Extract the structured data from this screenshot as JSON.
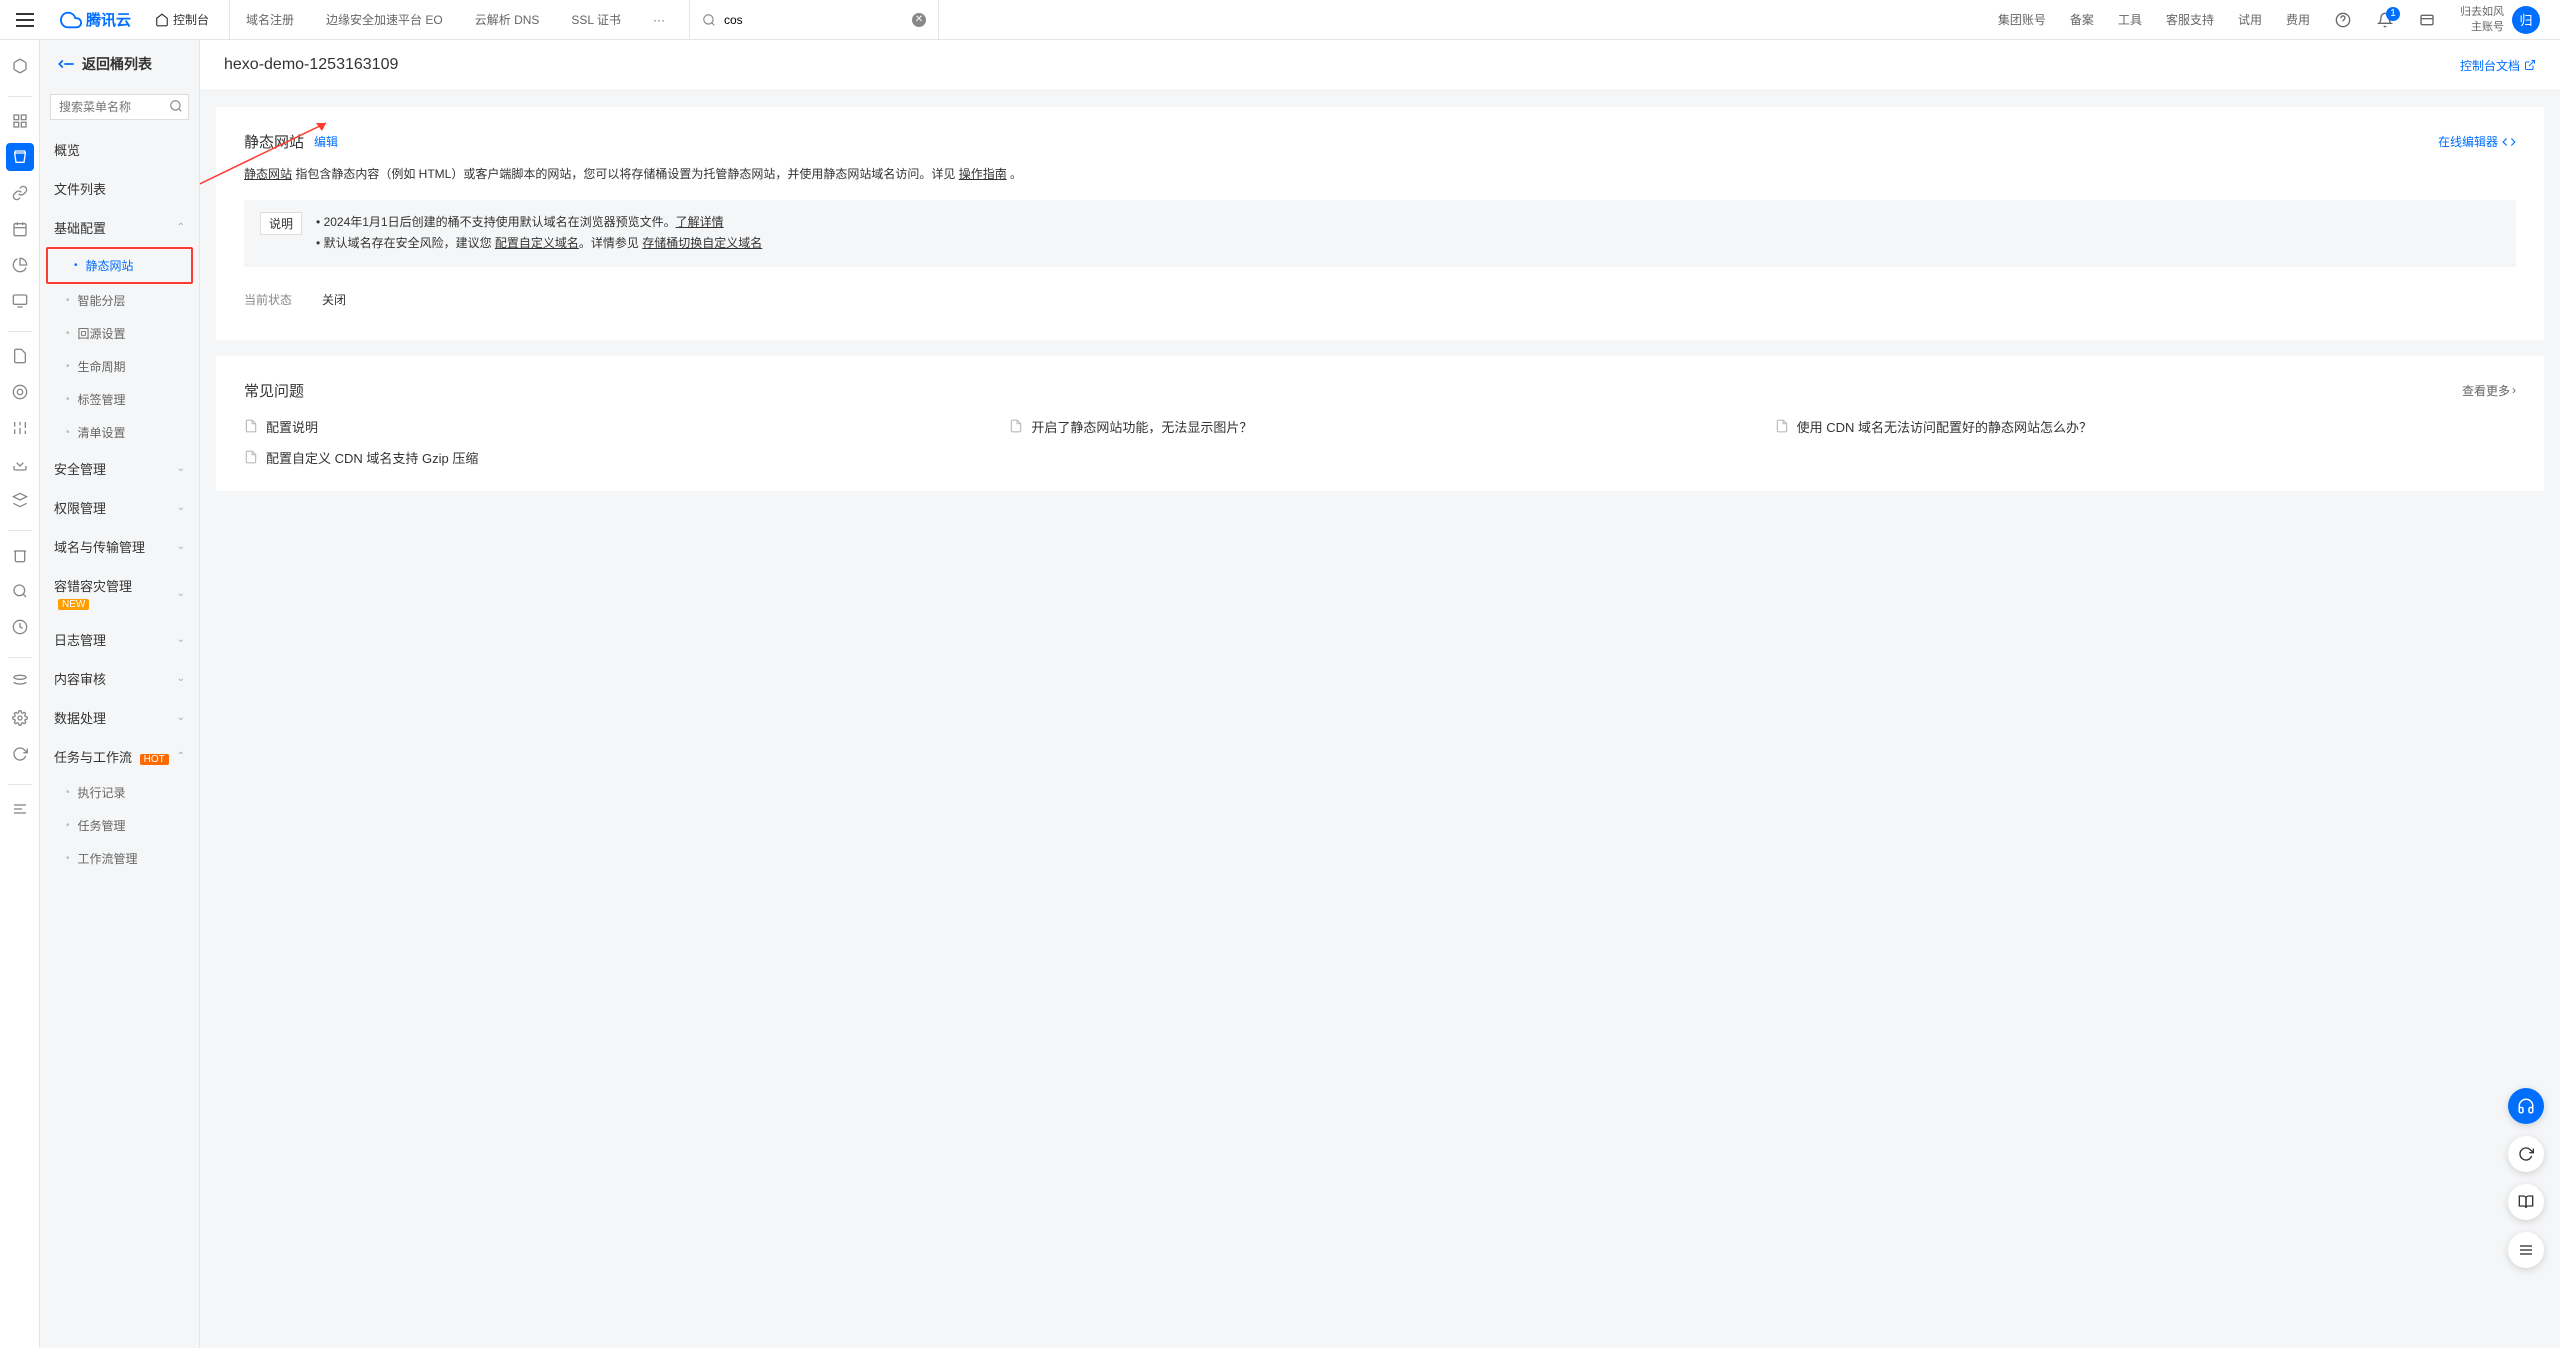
{
  "header": {
    "brand": "腾讯云",
    "console": "控制台",
    "nav": [
      "域名注册",
      "边缘安全加速平台 EO",
      "云解析 DNS",
      "SSL 证书",
      "···"
    ],
    "search_value": "cos",
    "right_links": [
      "集团账号",
      "备案",
      "工具",
      "客服支持",
      "试用",
      "费用"
    ],
    "notif_count": "1",
    "user_name": "归去如风",
    "user_sub": "主账号",
    "avatar_char": "归"
  },
  "sidebar": {
    "back": "返回桶列表",
    "search_placeholder": "搜索菜单名称",
    "items": {
      "overview": "概览",
      "filelist": "文件列表",
      "basic_config": "基础配置",
      "static_site": "静态网站",
      "smart_tier": "智能分层",
      "origin": "回源设置",
      "lifecycle": "生命周期",
      "tags": "标签管理",
      "inventory": "清单设置",
      "security": "安全管理",
      "permission": "权限管理",
      "domain_transport": "域名与传输管理",
      "fault_tolerant": "容错容灾管理",
      "log": "日志管理",
      "content_audit": "内容审核",
      "data_process": "数据处理",
      "task_workflow": "任务与工作流",
      "exec_record": "执行记录",
      "task_mgmt": "任务管理",
      "workflow_mgmt": "工作流管理",
      "new_badge": "NEW",
      "hot_badge": "HOT"
    }
  },
  "page": {
    "title": "hexo-demo-1253163109",
    "doc_link": "控制台文档"
  },
  "static_site": {
    "title": "静态网站",
    "edit": "编辑",
    "online_editor": "在线编辑器",
    "desc_prefix": "静态网站",
    "desc_body": " 指包含静态内容（例如 HTML）或客户端脚本的网站，您可以将存储桶设置为托管静态网站，并使用静态网站域名访问。详见 ",
    "desc_guide": "操作指南",
    "desc_period": " 。",
    "info_label": "说明",
    "info_bullet1_a": "2024年1月1日后创建的桶不支持使用默认域名在浏览器预览文件。",
    "info_bullet1_link": "了解详情",
    "info_bullet2_a": "默认域名存在安全风险，建议您 ",
    "info_bullet2_link1": "配置自定义域名",
    "info_bullet2_b": "。详情参见 ",
    "info_bullet2_link2": "存储桶切换自定义域名",
    "status_label": "当前状态",
    "status_value": "关闭"
  },
  "faq": {
    "title": "常见问题",
    "view_more": "查看更多",
    "items": [
      "配置说明",
      "开启了静态网站功能，无法显示图片？",
      "使用 CDN 域名无法访问配置好的静态网站怎么办？",
      "配置自定义 CDN 域名支持 Gzip 压缩"
    ]
  }
}
